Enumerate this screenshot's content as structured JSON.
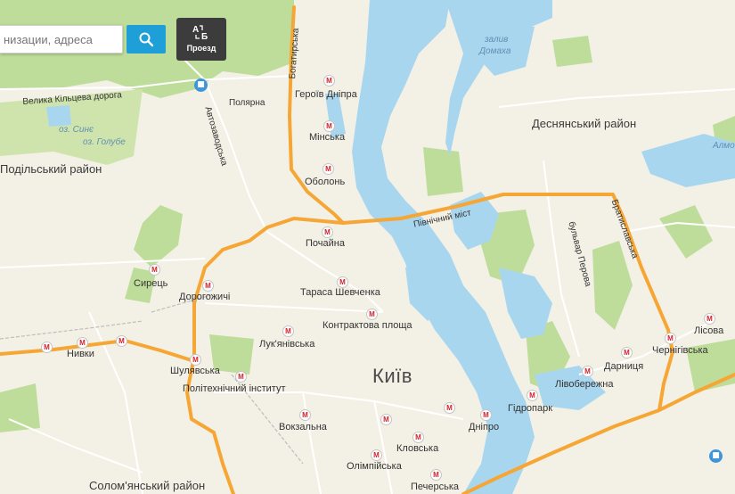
{
  "search": {
    "placeholder": "низации, адреса"
  },
  "toolbar": {
    "route_label": "Проезд"
  },
  "icons": {
    "search": "search-icon",
    "route": "route-icon",
    "metro": "metro-icon",
    "bus": "bus-station-icon"
  },
  "colors": {
    "water": "#a9d6ef",
    "parks": "#bfdd9a",
    "main_road": "#f6a635",
    "metro_marker": "#d3232b",
    "search_button": "#1e9fd7",
    "background": "#f3f1e6"
  },
  "map": {
    "city": "Київ",
    "districts": [
      "Подільський район",
      "Деснянський район",
      "Солом'янський район"
    ],
    "water": {
      "zaliv1": "залив",
      "zaliv2": "Домаха",
      "sine": "оз. Синє",
      "golube": "оз. Голубе",
      "almo": "Алмо"
    },
    "roads": {
      "kiltseva": "Велика Кільцева дорога",
      "polyarna": "Полярна",
      "avtozavodska": "Автозаводська",
      "bohatyrska": "Богатирська",
      "pivnichnyi_mist": "Північний міст",
      "perova": "бульвар Перова",
      "bratyslavska": "Братиславська"
    },
    "metro": {
      "heroiv_dnipra": "Героїв Дніпра",
      "minska": "Мінська",
      "obolon": "Оболонь",
      "pochaina": "Почайна",
      "taras": "Тараса Шевченка",
      "kontraktova": "Контрактова площа",
      "syrets": "Сирець",
      "dorohozhychi": "Дорогожичі",
      "lukianivska": "Лук'янівська",
      "nyvky": "Нивки",
      "shuliavska": "Шулявська",
      "politekh": "Політехнічний інститут",
      "vokzalna": "Вокзальна",
      "dnipro": "Дніпро",
      "klovska": "Кловська",
      "olimpiiska": "Олімпійська",
      "pecherska": "Печерська",
      "hidropark": "Гідропарк",
      "livoberezhna": "Лівобережна",
      "darnytsia": "Дарниця",
      "chernihivska": "Чернігівська",
      "lisova": "Лісова",
      "marker": "М"
    }
  }
}
